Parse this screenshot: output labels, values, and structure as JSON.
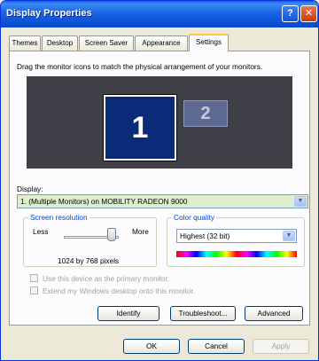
{
  "window": {
    "title": "Display Properties",
    "help_label": "?",
    "close_label": "✕"
  },
  "tabs": [
    {
      "label": "Themes"
    },
    {
      "label": "Desktop"
    },
    {
      "label": "Screen Saver"
    },
    {
      "label": "Appearance"
    },
    {
      "label": "Settings"
    }
  ],
  "active_tab": "Settings",
  "instructions": "Drag the monitor icons to match the physical arrangement of your monitors.",
  "monitors": [
    {
      "number": "1",
      "selected": true
    },
    {
      "number": "2",
      "selected": false
    }
  ],
  "display": {
    "label": "Display:",
    "value": "1. (Multiple Monitors) on MOBILITY RADEON 9000"
  },
  "resolution": {
    "title": "Screen resolution",
    "less_label": "Less",
    "more_label": "More",
    "value_text": "1024 by 768 pixels"
  },
  "color_quality": {
    "title": "Color quality",
    "value": "Highest (32 bit)"
  },
  "options": {
    "primary_label": "Use this device as the primary monitor.",
    "extend_label": "Extend my Windows desktop onto this monitor."
  },
  "buttons": {
    "identify": "Identify",
    "troubleshoot": "Troubleshoot...",
    "advanced": "Advanced",
    "ok": "OK",
    "cancel": "Cancel",
    "apply": "Apply"
  },
  "colors": {
    "titlebar": "#0a5ee9",
    "monitor_selected": "#0b2a78",
    "monitor_secondary": "#5f6a92",
    "display_field_bg": "#dfeecf",
    "group_title": "#0046d5"
  }
}
